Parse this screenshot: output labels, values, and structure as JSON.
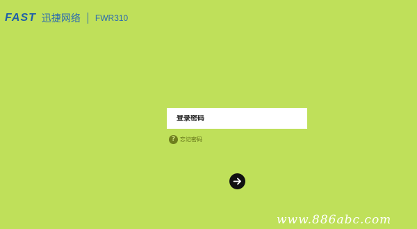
{
  "header": {
    "logo_text": "FAST",
    "brand_cn": "迅捷网络",
    "model": "FWR310"
  },
  "login": {
    "password_placeholder": "登录密码",
    "forgot_label": "忘记密码",
    "help_icon_glyph": "?",
    "submit_icon": "arrow-right-icon"
  },
  "watermark": {
    "text": "www.886abc.com"
  },
  "colors": {
    "background": "#bfe05a",
    "brand": "#1f5fa8",
    "input_bg": "#ffffff",
    "button_bg": "#111111"
  }
}
